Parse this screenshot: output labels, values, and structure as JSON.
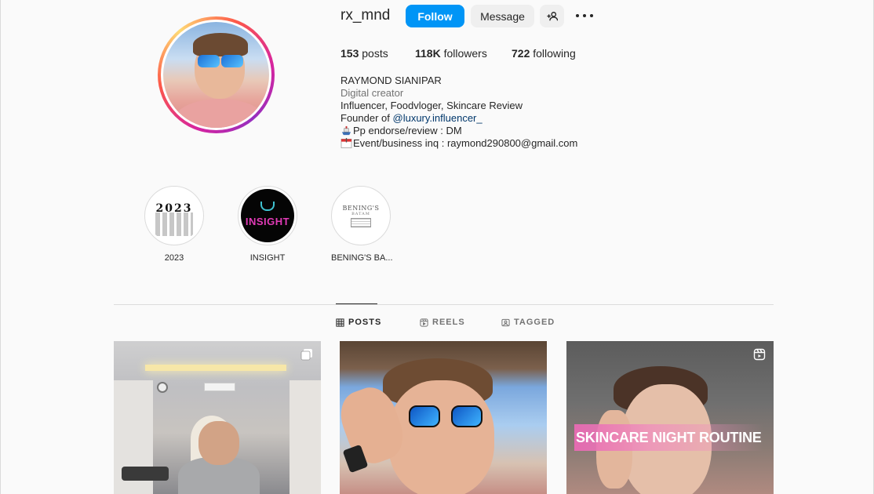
{
  "profile": {
    "username": "rx_mnd",
    "follow_label": "Follow",
    "message_label": "Message",
    "stats": {
      "posts_count": "153",
      "posts_label": "posts",
      "followers_count": "118K",
      "followers_label": "followers",
      "following_count": "722",
      "following_label": "following"
    },
    "bio": {
      "name": "RAYMOND SIANIPAR",
      "category": "Digital creator",
      "line1": "Influencer, Foodvloger, Skincare Review",
      "founder_prefix": "Founder of ",
      "founder_link": "@luxury.influencer_",
      "line3": "Pp endorse/review : DM",
      "line4": "Event/business inq : raymond290800@gmail.com"
    }
  },
  "highlights": [
    {
      "label": "2023",
      "image_text": "2023"
    },
    {
      "label": "INSIGHT",
      "image_text": "INSIGHT"
    },
    {
      "label": "BENING'S BA...",
      "image_text": "BENING'S",
      "image_subtext": "BATAM"
    }
  ],
  "tabs": [
    {
      "label": "POSTS",
      "icon": "grid-icon",
      "active": true
    },
    {
      "label": "REELS",
      "icon": "reels-icon",
      "active": false
    },
    {
      "label": "TAGGED",
      "icon": "tagged-icon",
      "active": false
    }
  ],
  "posts": [
    {
      "type": "carousel",
      "icon": "carousel-icon"
    },
    {
      "type": "photo"
    },
    {
      "type": "reel",
      "icon": "reel-icon",
      "overlay_text": "SKINCARE NIGHT ROUTINE"
    }
  ],
  "colors": {
    "accent": "#0095f6",
    "link": "#00376b",
    "button_secondary": "#efefef",
    "text": "#262626",
    "muted": "#737373"
  }
}
